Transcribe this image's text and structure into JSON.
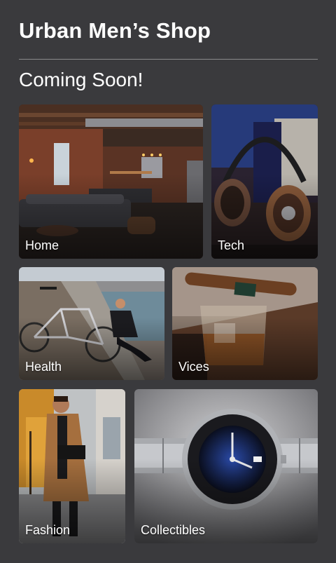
{
  "header": {
    "title": "Urban Men’s Shop"
  },
  "section": {
    "title": "Coming Soon!"
  },
  "categories": [
    {
      "label": "Home",
      "icon": "loft-interior-photo"
    },
    {
      "label": "Tech",
      "icon": "headphones-photo"
    },
    {
      "label": "Health",
      "icon": "bicycle-rider-photo"
    },
    {
      "label": "Vices",
      "icon": "cigar-whiskey-photo"
    },
    {
      "label": "Fashion",
      "icon": "man-in-coat-photo"
    },
    {
      "label": "Collectibles",
      "icon": "wristwatch-photo"
    }
  ]
}
